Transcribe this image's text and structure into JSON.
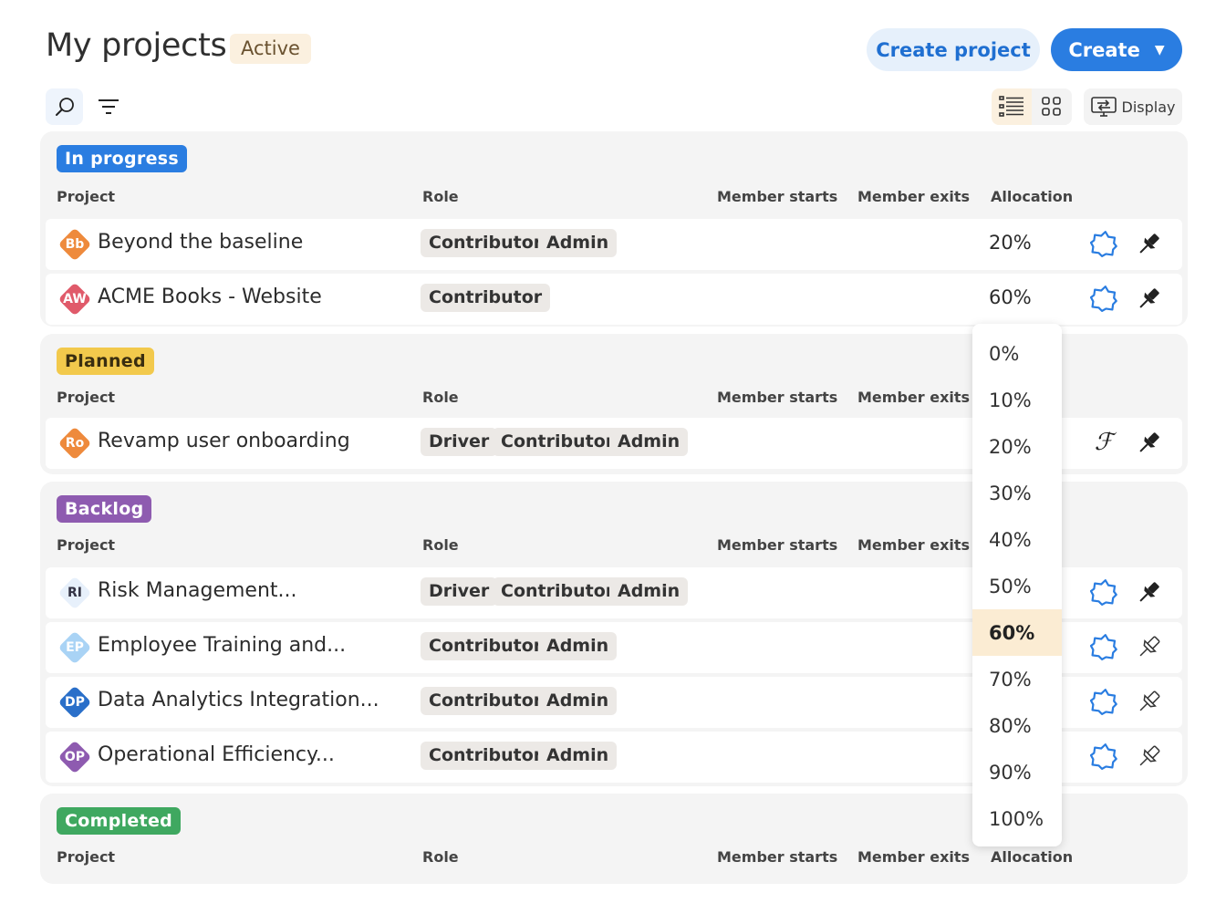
{
  "header": {
    "title": "My projects",
    "status_badge": "Active",
    "create_project_label": "Create project",
    "create_label": "Create"
  },
  "toolbar": {
    "search_icon": "search-icon",
    "filter_icon": "filter-icon",
    "list_view_icon": "list-view-icon",
    "grid_view_icon": "grid-view-icon",
    "display_label": "Display"
  },
  "columns": {
    "project": "Project",
    "role": "Role",
    "member_starts": "Member starts",
    "member_exits": "Member exits",
    "allocation": "Allocation"
  },
  "groups": [
    {
      "label": "In progress",
      "color": "#2a7de1",
      "rows": [
        {
          "initials": "Bb",
          "avatar_color": "#ee8a3c",
          "name": "Beyond the baseline",
          "roles": [
            "Contributor",
            "Admin"
          ],
          "allocation": "20%",
          "pinned": true
        },
        {
          "initials": "AW",
          "avatar_color": "#e05a6a",
          "name": "ACME Books - Website",
          "roles": [
            "Contributor"
          ],
          "allocation": "60%",
          "pinned": true
        }
      ]
    },
    {
      "label": "Planned",
      "color": "#f2c94c",
      "rows": [
        {
          "initials": "Ro",
          "avatar_color": "#ee8a3c",
          "name": "Revamp user onboarding",
          "roles": [
            "Driver",
            "Contributor",
            "Admin"
          ],
          "allocation": "",
          "pinned": true
        }
      ]
    },
    {
      "label": "Backlog",
      "color": "#8e5bb0",
      "rows": [
        {
          "initials": "RI",
          "avatar_color": "#e7f0fb",
          "name": "Risk Management...",
          "roles": [
            "Driver",
            "Contributor",
            "Admin"
          ],
          "allocation": "",
          "pinned": true
        },
        {
          "initials": "EP",
          "avatar_color": "#a9d3f5",
          "name": "Employee Training and...",
          "roles": [
            "Contributor",
            "Admin"
          ],
          "allocation": "",
          "pinned": false
        },
        {
          "initials": "DP",
          "avatar_color": "#2a6fc9",
          "name": "Data Analytics Integration...",
          "roles": [
            "Contributor",
            "Admin"
          ],
          "allocation": "",
          "pinned": false
        },
        {
          "initials": "OP",
          "avatar_color": "#8e5bb0",
          "name": "Operational Efficiency...",
          "roles": [
            "Contributor",
            "Admin"
          ],
          "allocation": "",
          "pinned": false
        }
      ]
    },
    {
      "label": "Completed",
      "color": "#3fa860",
      "rows": []
    }
  ],
  "allocation_dropdown": {
    "options": [
      "0%",
      "10%",
      "20%",
      "30%",
      "40%",
      "50%",
      "60%",
      "70%",
      "80%",
      "90%",
      "100%"
    ],
    "selected": "60%"
  },
  "colors": {
    "accent": "#2a7de1",
    "star_icon": "#2a7de1"
  }
}
